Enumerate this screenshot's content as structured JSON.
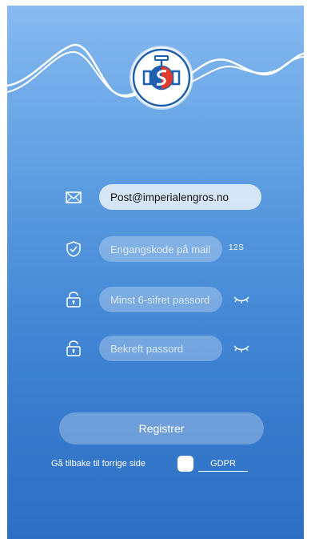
{
  "logo": {
    "icon": "valve-logo-icon"
  },
  "form": {
    "email": {
      "value": "Post@imperialengros.no",
      "icon": "mail-icon"
    },
    "code": {
      "placeholder": "Engangskode på mail",
      "timer": "12S",
      "icon": "shield-check-icon"
    },
    "password": {
      "placeholder": "Minst 6-sifret passord",
      "icon": "unlock-icon",
      "eye_icon": "eye-closed-icon"
    },
    "confirm": {
      "placeholder": "Bekreft passord",
      "icon": "unlock-icon",
      "eye_icon": "eye-closed-icon"
    }
  },
  "actions": {
    "register_label": "Registrer",
    "back_label": "Gå tilbake til forrige side",
    "gdpr_label": "GDPR"
  },
  "colors": {
    "gradient_top": "#87baf0",
    "gradient_bottom": "#2d6fc4",
    "logo_red": "#e03a2e",
    "logo_blue": "#1f5fb0"
  }
}
